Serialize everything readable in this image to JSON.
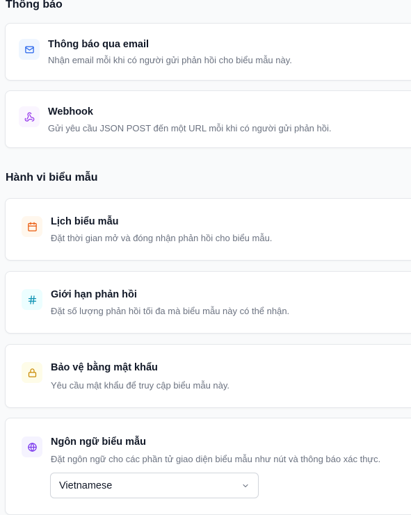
{
  "sections": {
    "notifications_title": "Thông báo",
    "behavior_title": "Hành vi biểu mẫu"
  },
  "cards": {
    "email": {
      "title": "Thông báo qua email",
      "description": "Nhận email mỗi khi có người gửi phản hồi cho biểu mẫu này.",
      "icon": "mail-icon",
      "icon_color": "#2563eb",
      "icon_bg": "#eff6ff"
    },
    "webhook": {
      "title": "Webhook",
      "description": "Gửi yêu cầu JSON POST đến một URL mỗi khi có người gửi phản hồi.",
      "icon": "webhook-icon",
      "icon_color": "#9333ea",
      "icon_bg": "#faf5ff"
    },
    "schedule": {
      "title": "Lịch biểu mẫu",
      "description": "Đặt thời gian mở và đóng nhận phản hồi cho biểu mẫu.",
      "icon": "calendar-icon",
      "icon_color": "#ea580c",
      "icon_bg": "#fff7ed"
    },
    "limit": {
      "title": "Giới hạn phản hồi",
      "description": "Đặt số lượng phản hồi tối đa mà biểu mẫu này có thể nhận.",
      "icon": "hash-icon",
      "icon_color": "#0891b2",
      "icon_bg": "#ecfeff"
    },
    "password": {
      "title": "Bảo vệ bằng mật khẩu",
      "description": "Yêu cầu mật khẩu để truy cập biểu mẫu này.",
      "icon": "lock-icon",
      "icon_color": "#ca8a04",
      "icon_bg": "#fefce8"
    },
    "language": {
      "title": "Ngôn ngữ biểu mẫu",
      "description": "Đặt ngôn ngữ cho các phần tử giao diện biểu mẫu như nút và thông báo xác thực.",
      "icon": "globe-icon",
      "icon_color": "#7c3aed",
      "icon_bg": "#f5f3ff",
      "selected_language": "Vietnamese"
    }
  }
}
